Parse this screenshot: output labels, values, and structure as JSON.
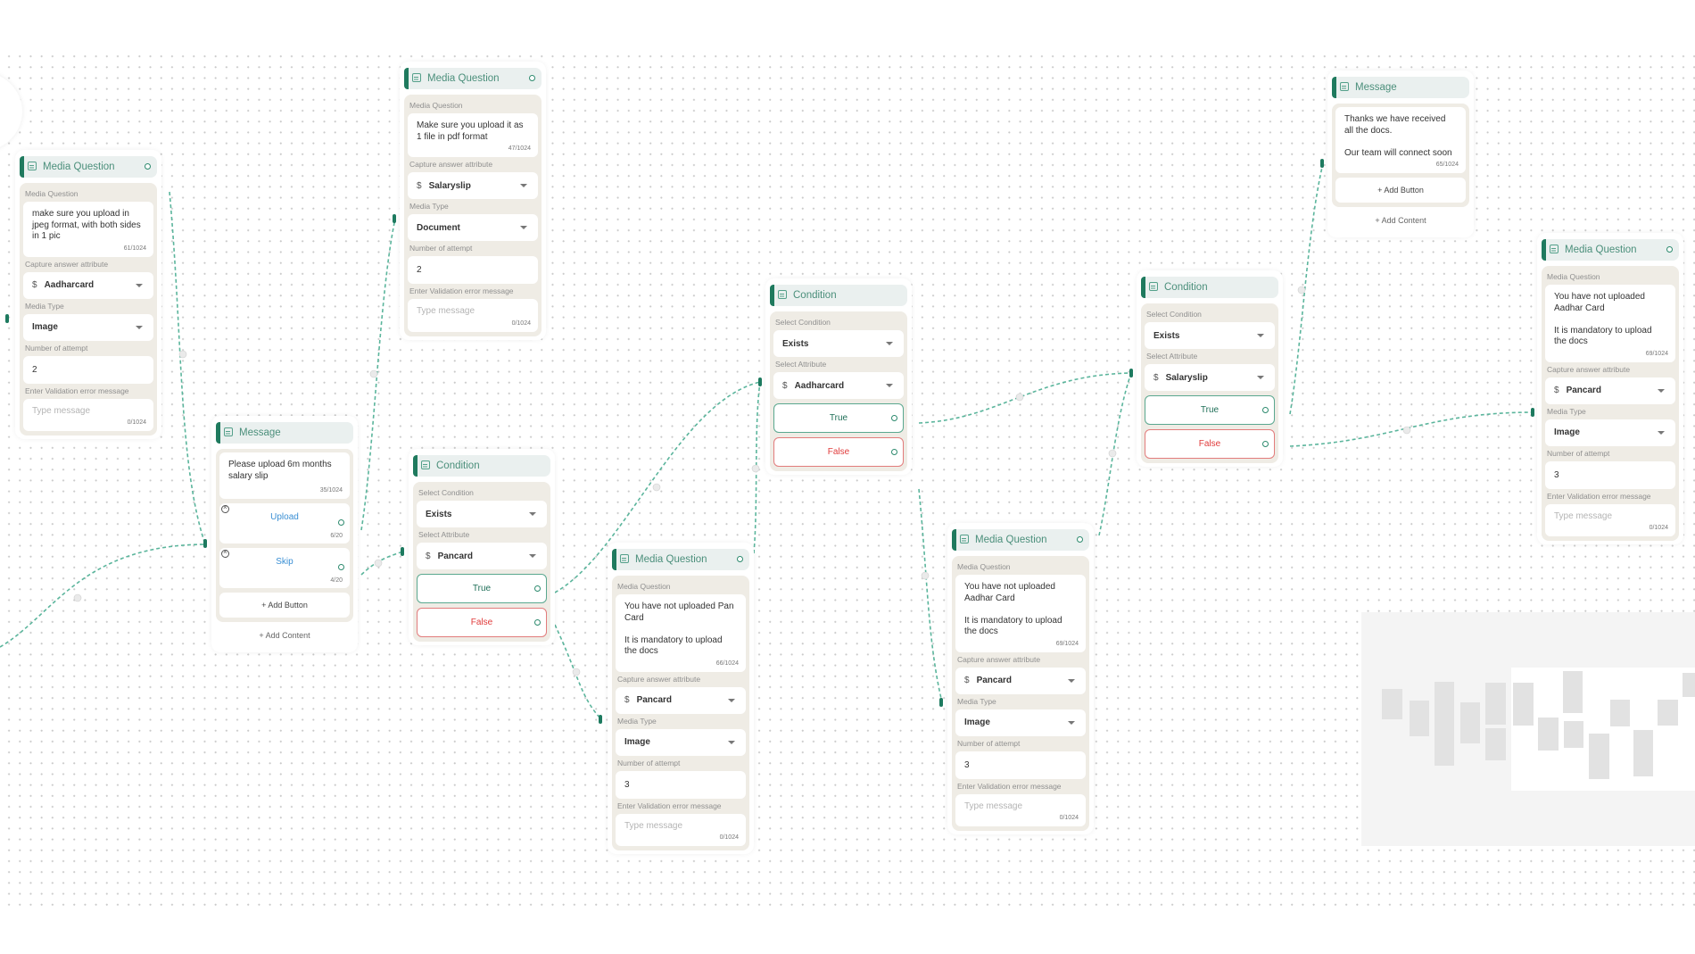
{
  "canvas": {
    "accent_color": "#1f7a5e",
    "edge_color": "#5bb59c",
    "false_color": "#e03a3a"
  },
  "nodes": {
    "mq1": {
      "type": "Media Question",
      "question_label": "Media Question",
      "question_text": "make sure you upload in jpeg format, with both sides in 1 pic",
      "question_counter": "61/1024",
      "attribute_label": "Capture answer attribute",
      "attribute_value": "Aadharcard",
      "media_type_label": "Media Type",
      "media_type_value": "Image",
      "attempts_label": "Number of attempt",
      "attempts_value": "2",
      "error_label": "Enter Validation error message",
      "error_placeholder": "Type message",
      "error_counter": "0/1024"
    },
    "msg1": {
      "type": "Message",
      "text": "Please upload 6m months salary slip",
      "counter": "35/1024",
      "buttons": [
        {
          "label": "Upload",
          "counter": "6/20"
        },
        {
          "label": "Skip",
          "counter": "4/20"
        }
      ],
      "add_button": "+ Add Button",
      "add_content": "+ Add Content"
    },
    "mq2": {
      "type": "Media Question",
      "question_label": "Media Question",
      "question_text": "Make sure you upload it as 1 file in pdf format",
      "question_counter": "47/1024",
      "attribute_label": "Capture answer attribute",
      "attribute_value": "Salaryslip",
      "media_type_label": "Media Type",
      "media_type_value": "Document",
      "attempts_label": "Number of attempt",
      "attempts_value": "2",
      "error_label": "Enter Validation error message",
      "error_placeholder": "Type message",
      "error_counter": "0/1024"
    },
    "cond1": {
      "type": "Condition",
      "condition_label": "Select Condition",
      "condition_value": "Exists",
      "attribute_label": "Select Attribute",
      "attribute_value": "Pancard",
      "true_label": "True",
      "false_label": "False"
    },
    "mq3": {
      "type": "Media Question",
      "question_label": "Media Question",
      "question_text": "You have not uploaded Pan Card\n\nIt is mandatory to upload the docs",
      "question_counter": "66/1024",
      "attribute_label": "Capture answer attribute",
      "attribute_value": "Pancard",
      "media_type_label": "Media Type",
      "media_type_value": "Image",
      "attempts_label": "Number of attempt",
      "attempts_value": "3",
      "error_label": "Enter Validation error message",
      "error_placeholder": "Type message",
      "error_counter": "0/1024"
    },
    "cond2": {
      "type": "Condition",
      "condition_label": "Select Condition",
      "condition_value": "Exists",
      "attribute_label": "Select Attribute",
      "attribute_value": "Aadharcard",
      "true_label": "True",
      "false_label": "False"
    },
    "mq4": {
      "type": "Media Question",
      "question_label": "Media Question",
      "question_text": "You have not uploaded Aadhar Card\n\nIt is mandatory to upload the docs",
      "question_counter": "69/1024",
      "attribute_label": "Capture answer attribute",
      "attribute_value": "Pancard",
      "media_type_label": "Media Type",
      "media_type_value": "Image",
      "attempts_label": "Number of attempt",
      "attempts_value": "3",
      "error_label": "Enter Validation error message",
      "error_placeholder": "Type message",
      "error_counter": "0/1024"
    },
    "cond3": {
      "type": "Condition",
      "condition_label": "Select Condition",
      "condition_value": "Exists",
      "attribute_label": "Select Attribute",
      "attribute_value": "Salaryslip",
      "true_label": "True",
      "false_label": "False"
    },
    "msg2": {
      "type": "Message",
      "text": "Thanks we have received all the docs.\n\nOur team will connect soon",
      "counter": "65/1024",
      "add_button": "+ Add Button",
      "add_content": "+ Add Content"
    },
    "mq5": {
      "type": "Media Question",
      "question_label": "Media Question",
      "question_text": "You have not uploaded Aadhar Card\n\nIt is mandatory to upload the docs",
      "question_counter": "69/1024",
      "attribute_label": "Capture answer attribute",
      "attribute_value": "Pancard",
      "media_type_label": "Media Type",
      "media_type_value": "Image",
      "attempts_label": "Number of attempt",
      "attempts_value": "3",
      "error_label": "Enter Validation error message",
      "error_placeholder": "Type message",
      "error_counter": "0/1024"
    }
  },
  "icons": {
    "node_header": "message-square-icon",
    "attribute": "dollar-icon",
    "dropdown": "chevron-down-icon",
    "remove_button": "close-circle-icon",
    "output_port": "circle-port-icon"
  }
}
